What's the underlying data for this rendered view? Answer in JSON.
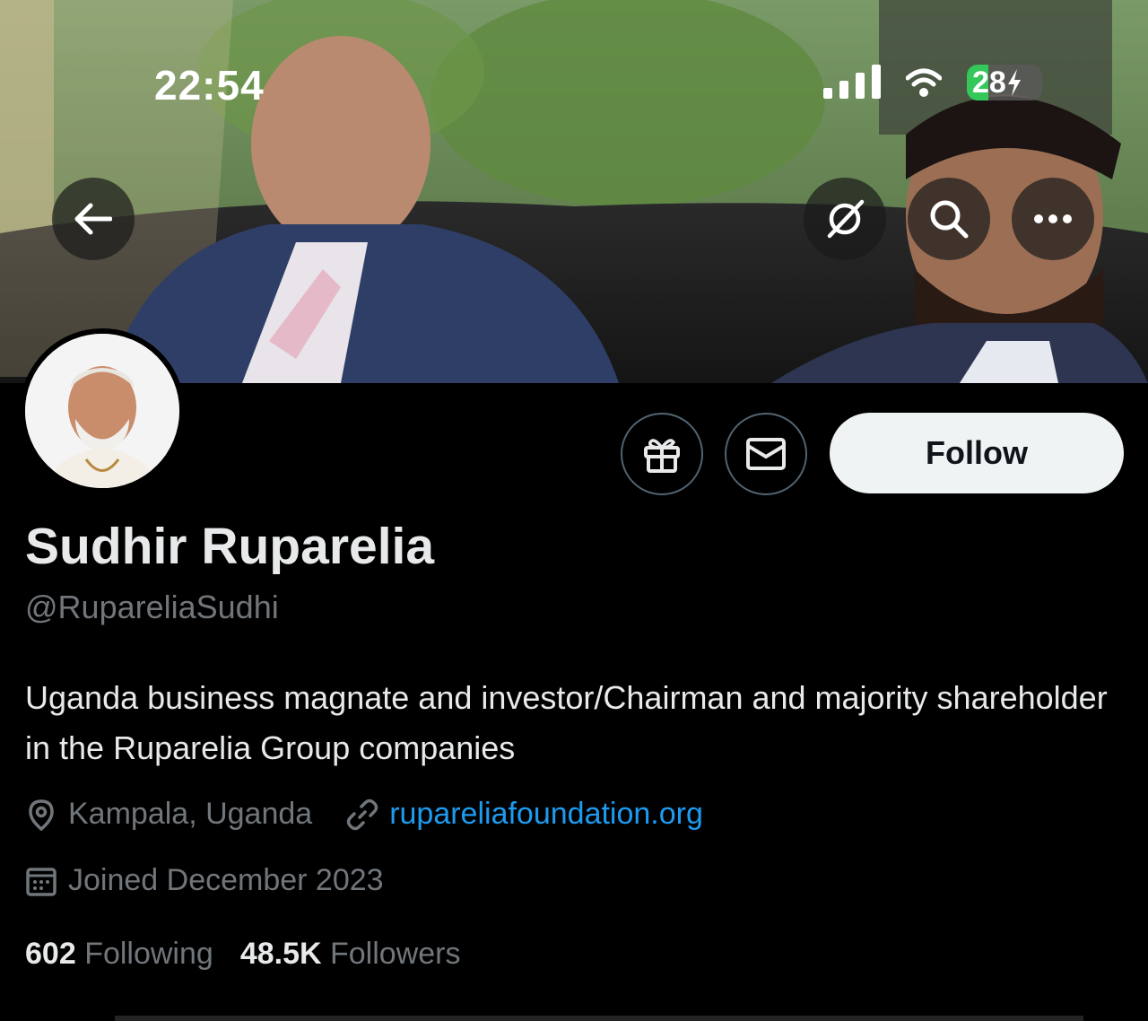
{
  "status_bar": {
    "time": "22:54",
    "battery": "28"
  },
  "header": {
    "back_icon": "arrow-left-icon",
    "grok_icon": "grok-icon",
    "search_icon": "search-icon",
    "more_icon": "more-horizontal-icon"
  },
  "profile": {
    "name": "Sudhir Ruparelia",
    "handle": "@RupareliaSudhi",
    "bio": "Uganda business magnate and investor/Chairman and majority shareholder in the Ruparelia Group companies",
    "location": "Kampala, Uganda",
    "website": "rupareliafoundation.org",
    "joined": "Joined December 2023",
    "following_count": "602",
    "following_label": "Following",
    "followers_count": "48.5K",
    "followers_label": "Followers"
  },
  "actions": {
    "follow_label": "Follow",
    "gift_icon": "gift-icon",
    "message_icon": "mail-icon"
  },
  "colors": {
    "accent": "#1d9bf0",
    "background": "#000000",
    "secondary_text": "#71767b",
    "battery_green": "#34c759"
  }
}
